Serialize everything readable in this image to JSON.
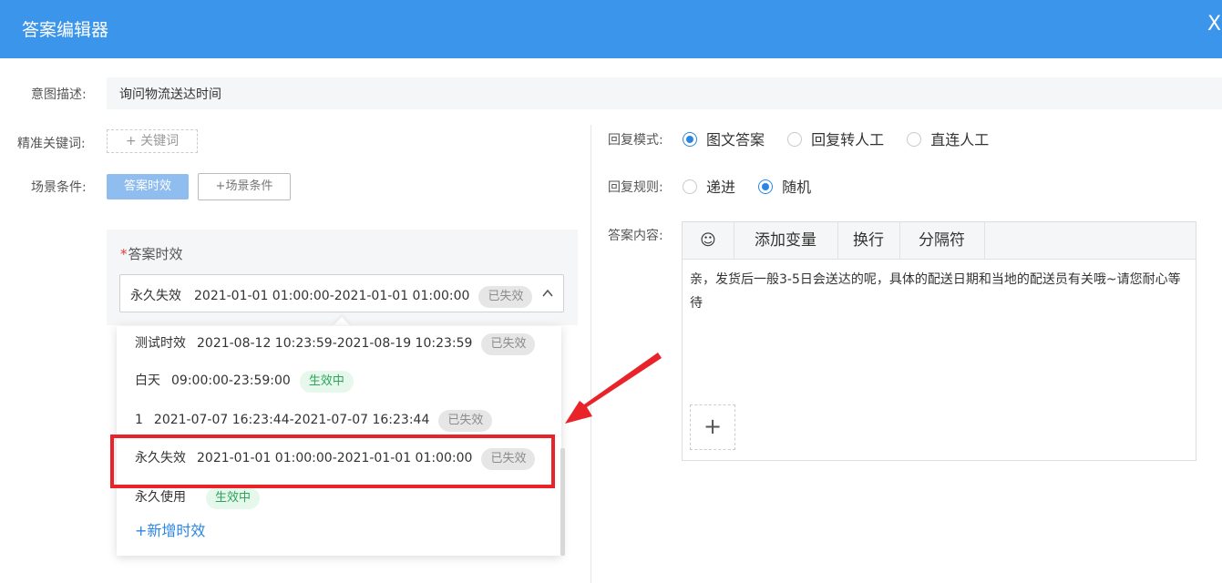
{
  "header": {
    "title": "答案编辑器",
    "close": "X"
  },
  "form": {
    "intent_label": "意图描述:",
    "intent_value": "询问物流送达时间",
    "keyword_label": "精准关键词:",
    "keyword_add": "+ 关键词",
    "scene_label": "场景条件:",
    "scene_tag": "答案时效",
    "scene_add": "+场景条件"
  },
  "validity": {
    "label": "答案时效",
    "selected": {
      "name": "永久失效",
      "range": "2021-01-01 01:00:00-2021-01-01 01:00:00",
      "status": "已失效"
    },
    "options": [
      {
        "name": "测试时效",
        "range": "2021-08-12 10:23:59-2021-08-19 10:23:59",
        "status": "已失效"
      },
      {
        "name": "白天",
        "range": "09:00:00-23:59:00",
        "status": "生效中"
      },
      {
        "name": "1",
        "range": "2021-07-07 16:23:44-2021-07-07 16:23:44",
        "status": "已失效"
      },
      {
        "name": "永久失效",
        "range": "2021-01-01 01:00:00-2021-01-01 01:00:00",
        "status": "已失效"
      },
      {
        "name": "永久使用",
        "range": "",
        "status": "生效中"
      }
    ],
    "add_label": "+新增时效"
  },
  "reply": {
    "mode_label": "回复模式:",
    "modes": [
      "图文答案",
      "回复转人工",
      "直连人工"
    ],
    "mode_selected": "图文答案",
    "rule_label": "回复规则:",
    "rules": [
      "递进",
      "随机"
    ],
    "rule_selected": "随机",
    "content_label": "答案内容:",
    "toolbar": {
      "emoji": "☺",
      "variable": "添加变量",
      "newline": "换行",
      "separator": "分隔符"
    },
    "content_text": "亲，发货后一般3-5日会送达的呢，具体的配送日期和当地的配送员有关哦~请您耐心等待",
    "add_media": "+"
  },
  "colors": {
    "header": "#3b95eb",
    "accent": "#2b86e3",
    "highlight": "#e8242a"
  }
}
